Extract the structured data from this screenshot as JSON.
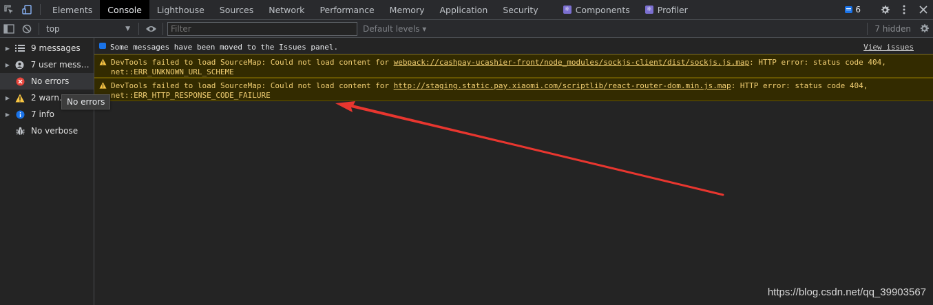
{
  "tabs": [
    {
      "label": "Elements"
    },
    {
      "label": "Console",
      "active": true
    },
    {
      "label": "Lighthouse"
    },
    {
      "label": "Sources"
    },
    {
      "label": "Network"
    },
    {
      "label": "Performance"
    },
    {
      "label": "Memory"
    },
    {
      "label": "Application"
    },
    {
      "label": "Security"
    }
  ],
  "react_tabs": [
    {
      "label": "Components",
      "icon": "react-icon"
    },
    {
      "label": "Profiler",
      "icon": "react-icon"
    }
  ],
  "issues_badge_count": "6",
  "toolbar": {
    "context": "top",
    "filter_placeholder": "Filter",
    "levels": "Default levels ▾",
    "hidden": "7 hidden"
  },
  "sidebar": {
    "items": [
      {
        "label": "9 messages",
        "icon": "list-icon",
        "expandable": true
      },
      {
        "label": "7 user messa…",
        "icon": "user-icon",
        "expandable": true
      },
      {
        "label": "No errors",
        "icon": "error-icon",
        "expandable": false,
        "selected": true
      },
      {
        "label": "2 warn…",
        "icon": "warning-icon",
        "expandable": true
      },
      {
        "label": "7 info",
        "icon": "info-icon",
        "expandable": true
      },
      {
        "label": "No verbose",
        "icon": "bug-icon",
        "expandable": false
      }
    ],
    "tooltip": "No errors"
  },
  "messages": {
    "info": {
      "text": "Some messages have been moved to the Issues panel.",
      "link": "View issues"
    },
    "warnings": [
      {
        "prefix": "DevTools failed to load SourceMap: Could not load content for ",
        "url": "webpack://cashpay-ucashier-front/node_modules/sockjs-client/dist/sockjs.js.map",
        "suffix": ": HTTP error: status code 404,",
        "line2": "net::ERR_UNKNOWN_URL_SCHEME"
      },
      {
        "prefix": "DevTools failed to load SourceMap: Could not load content for ",
        "url": "http://staging.static.pay.xiaomi.com/scriptlib/react-router-dom.min.js.map",
        "suffix": ": HTTP error: status code 404,",
        "line2": "net::ERR_HTTP_RESPONSE_CODE_FAILURE"
      }
    ]
  },
  "watermark": "https://blog.csdn.net/qq_39903567",
  "colors": {
    "warning_bg": "#332b00",
    "warning_text": "#f2cf73",
    "accent_blue": "#1a73e8",
    "error_red": "#e8453c",
    "annotation_arrow": "#e8362f"
  }
}
